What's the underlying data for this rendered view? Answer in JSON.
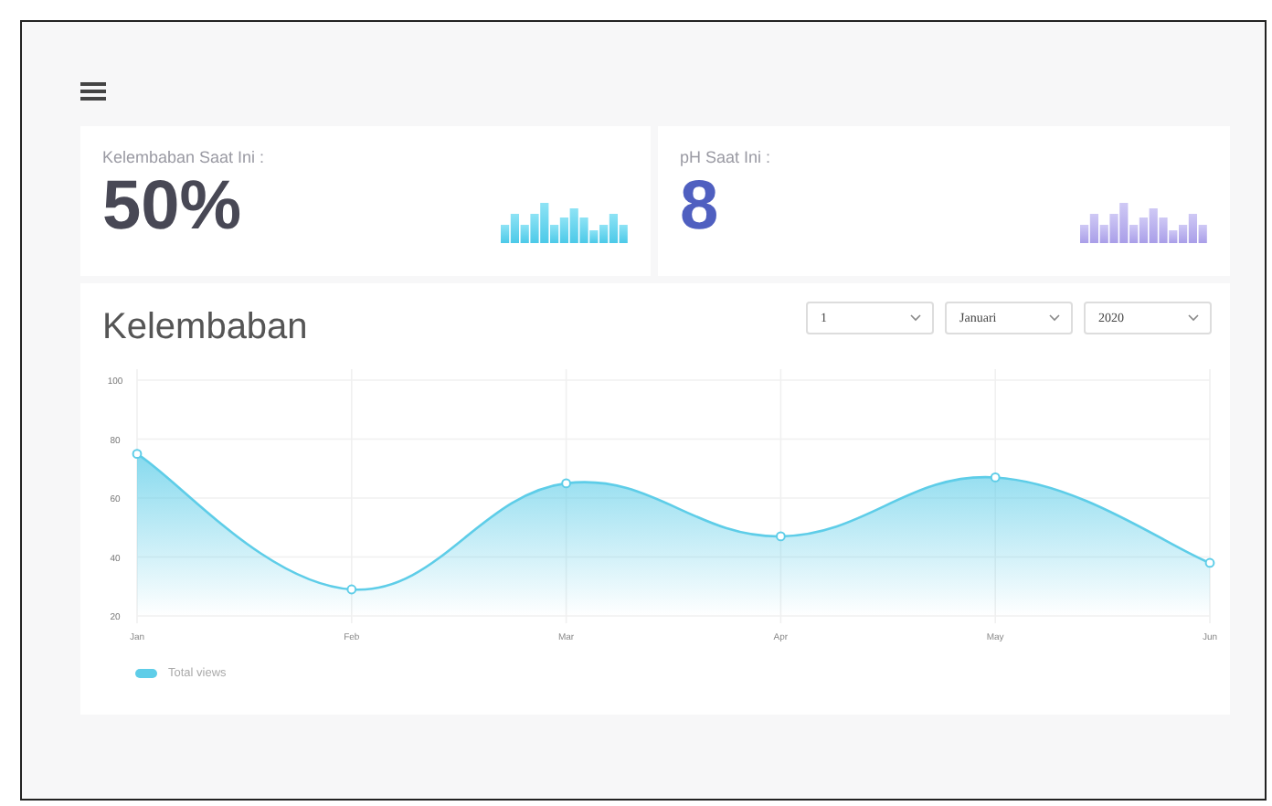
{
  "stats": [
    {
      "kind": "humidity",
      "label": "Kelembaban Saat Ini :",
      "value": "50%"
    },
    {
      "kind": "ph",
      "label": "pH Saat Ini :",
      "value": "8"
    }
  ],
  "chart_card": {
    "title": "Kelembaban",
    "filters": [
      "1",
      "Januari",
      "2020"
    ],
    "chart_data": {
      "type": "area",
      "categories": [
        "Jan",
        "Feb",
        "Mar",
        "Apr",
        "May",
        "Jun"
      ],
      "series": [
        {
          "name": "Total views",
          "color": "#5ecde8",
          "values": [
            75,
            29,
            65,
            47,
            67,
            38
          ]
        }
      ],
      "grid": true,
      "ylim": [
        20,
        100
      ],
      "yticks": [
        20,
        40,
        60,
        80,
        100
      ]
    }
  }
}
